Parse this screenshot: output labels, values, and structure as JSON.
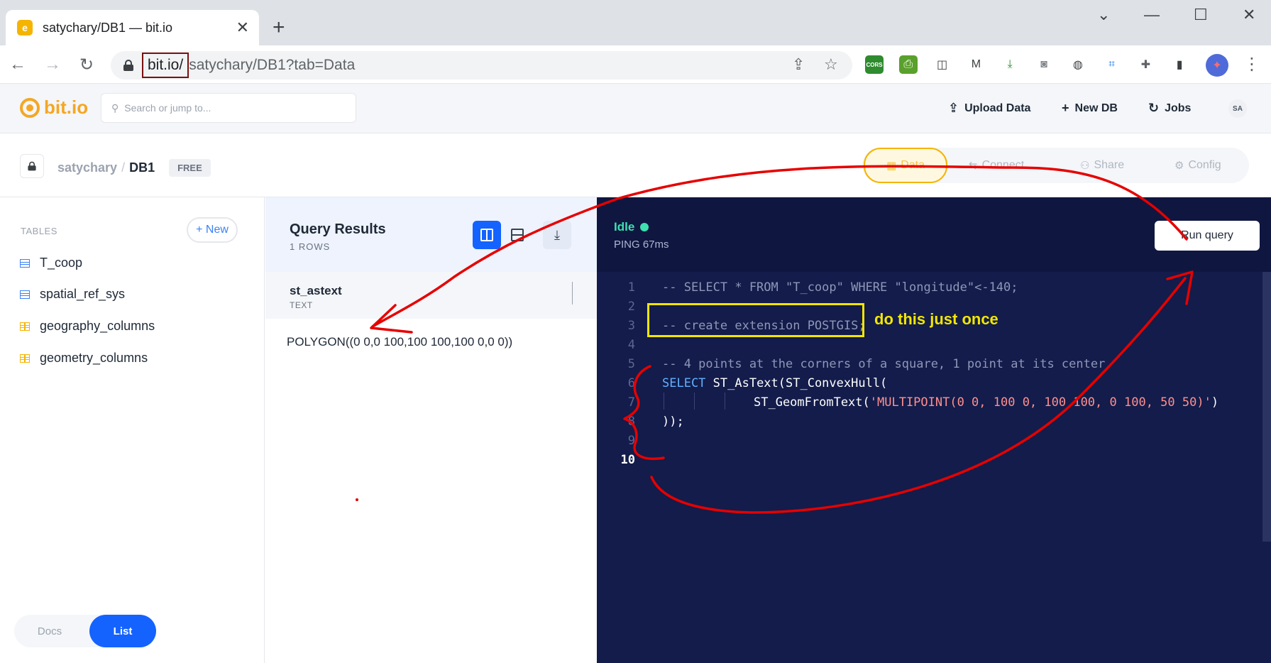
{
  "browser": {
    "tab_title": "satychary/DB1 — bit.io",
    "tab_favicon": "bit.io-favicon",
    "url_host": "bit.io/",
    "url_path": "satychary/DB1?tab=Data",
    "extensions": [
      {
        "name": "cors-extension-icon",
        "label": "CORS",
        "color": "#2e8b2e"
      },
      {
        "name": "printer-extension-icon",
        "label": "",
        "color": "#5aa02c"
      },
      {
        "name": "camera-extension-icon",
        "label": "",
        "color": "#ffffff"
      },
      {
        "name": "malwarebytes-extension-icon",
        "label": "",
        "color": "#ffffff"
      },
      {
        "name": "download-extension-icon",
        "label": "",
        "color": "#ffffff"
      },
      {
        "name": "screenshot-extension-icon",
        "label": "",
        "color": "#ffffff"
      },
      {
        "name": "globe-extension-icon",
        "label": "",
        "color": "#ffffff"
      },
      {
        "name": "crop-extension-icon",
        "label": "",
        "color": "#ffffff"
      },
      {
        "name": "puzzle-extensions-icon",
        "label": "",
        "color": "#ffffff"
      },
      {
        "name": "side-panel-icon",
        "label": "",
        "color": "#ffffff"
      }
    ]
  },
  "header": {
    "brand": "bit.io",
    "search_placeholder": "Search or jump to...",
    "upload_label": "Upload Data",
    "newdb_label": "New DB",
    "jobs_label": "Jobs",
    "avatar_initials": "SA"
  },
  "db": {
    "owner": "satychary",
    "separator": "/",
    "name": "DB1",
    "plan_badge": "FREE",
    "tabs": [
      {
        "label": "Data",
        "active": true
      },
      {
        "label": "Connect",
        "active": false
      },
      {
        "label": "Share",
        "active": false
      },
      {
        "label": "Config",
        "active": false
      }
    ]
  },
  "sidebar": {
    "section_label": "TABLES",
    "new_label": "+ New",
    "tables": [
      {
        "label": "T_coop",
        "kind": "table"
      },
      {
        "label": "spatial_ref_sys",
        "kind": "table"
      },
      {
        "label": "geography_columns",
        "kind": "view"
      },
      {
        "label": "geometry_columns",
        "kind": "view"
      }
    ],
    "toggle": {
      "docs_label": "Docs",
      "list_label": "List",
      "active": "List"
    }
  },
  "results": {
    "title": "Query Results",
    "rows_label": "1 ROWS",
    "columns": [
      {
        "name": "st_astext",
        "type": "TEXT"
      }
    ],
    "rows": [
      [
        "POLYGON((0 0,0 100,100 100,100 0,0 0))"
      ]
    ]
  },
  "editor": {
    "status": "Idle",
    "ping": "PING 67ms",
    "run_label": "Run query",
    "line_numbers": [
      "1",
      "2",
      "3",
      "4",
      "5",
      "6",
      "7",
      "8",
      "9",
      "10"
    ],
    "active_line": "10",
    "lines": {
      "l1": "-- SELECT * FROM \"T_coop\" WHERE \"longitude\"<-140;",
      "l3": "-- create extension POSTGIS;",
      "l5": "-- 4 points at the corners of a square, 1 point at its center",
      "l6_kw": "SELECT",
      "l6_fn": " ST_AsText(ST_ConvexHull(",
      "l7_fn": "ST_GeomFromText(",
      "l7_str": "'MULTIPOINT(0 0, 100 0, 100 100, 0 100, 50 50)'",
      "l7_end": ")",
      "l8": "));"
    }
  },
  "annotation": {
    "note": "do this just once",
    "box_color": "#f2e600",
    "arrow_color": "#e60000"
  }
}
